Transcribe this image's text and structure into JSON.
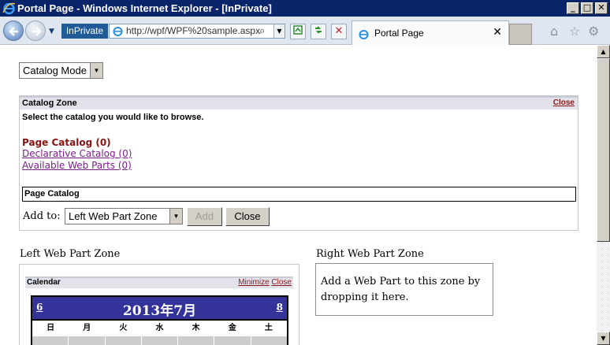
{
  "window": {
    "title": "Portal Page - Windows Internet Explorer - [InPrivate]",
    "controls": {
      "minimize": "_",
      "maximize": "□",
      "close": "✕"
    }
  },
  "toolbar": {
    "inprivate_label": "InPrivate",
    "address": "http://wpf/WPF%20sample.aspx",
    "tab_title": "Portal Page",
    "tab_close": "✕"
  },
  "page": {
    "mode_select": "Catalog Mode",
    "catalog_zone": {
      "header": "Catalog Zone",
      "close_label": "Close",
      "instruction": "Select the catalog you would like to browse.",
      "catalogs": [
        {
          "label": "Page Catalog (0)",
          "active": true
        },
        {
          "label": "Declarative Catalog (0)",
          "active": false
        },
        {
          "label": "Available Web Parts (0)",
          "active": false
        }
      ],
      "selected_catalog_title": "Page Catalog",
      "add_to_label": "Add to:",
      "add_to_value": "Left Web Part Zone",
      "add_button": "Add",
      "close_button": "Close"
    },
    "left_zone": {
      "title": "Left Web Part Zone",
      "calendar_part": {
        "title": "Calendar",
        "minimize_label": "Minimize",
        "close_label": "Close",
        "prev": "6",
        "next": "8",
        "month": "2013年7月",
        "days_of_week": [
          "日",
          "月",
          "火",
          "水",
          "木",
          "金",
          "土"
        ]
      }
    },
    "right_zone": {
      "title": "Right Web Part Zone",
      "empty_text": "Add a Web Part to this zone by dropping it here."
    }
  },
  "colors": {
    "titlebar": "#0a246a",
    "calendar_title_bg": "#333399",
    "link_visited": "#7b1f8a",
    "link_active": "#8a1111"
  }
}
